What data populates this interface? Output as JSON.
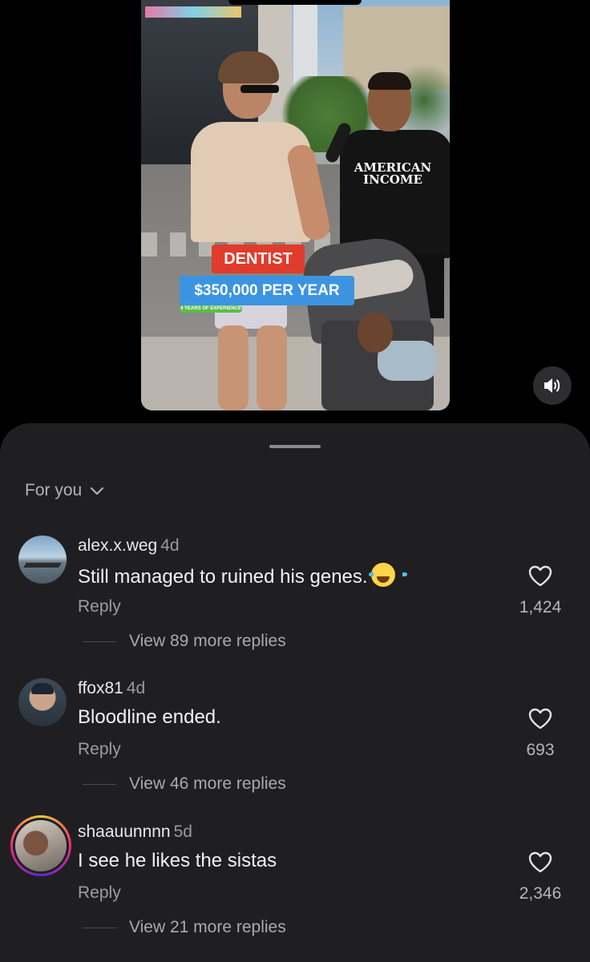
{
  "video": {
    "overlay_job": "DENTIST",
    "overlay_salary": "$350,000 PER YEAR",
    "overlay_experience": "4 YEARS OF EXPERIENCE",
    "shirt_text": "AMERICAN INCOME",
    "sound_icon": "speaker-icon"
  },
  "comments_sheet": {
    "filter_label": "For you",
    "comments": [
      {
        "username": "alex.x.weg",
        "time": "4d",
        "text": "Still managed to ruined his genes.",
        "emoji": "😂",
        "reply_label": "Reply",
        "view_replies": "View 89 more replies",
        "likes": "1,424"
      },
      {
        "username": "ffox81",
        "time": "4d",
        "text": "Bloodline ended.",
        "reply_label": "Reply",
        "view_replies": "View 46 more replies",
        "likes": "693"
      },
      {
        "username": "shaauunnnn",
        "time": "5d",
        "text": "I see he likes the sistas",
        "reply_label": "Reply",
        "view_replies": "View 21 more replies",
        "likes": "2,346"
      }
    ]
  },
  "colors": {
    "sheet_bg": "#1f1f22",
    "overlay_red": "#e13b2c",
    "overlay_blue": "#3c94e0",
    "overlay_green": "#5cbd4a"
  }
}
